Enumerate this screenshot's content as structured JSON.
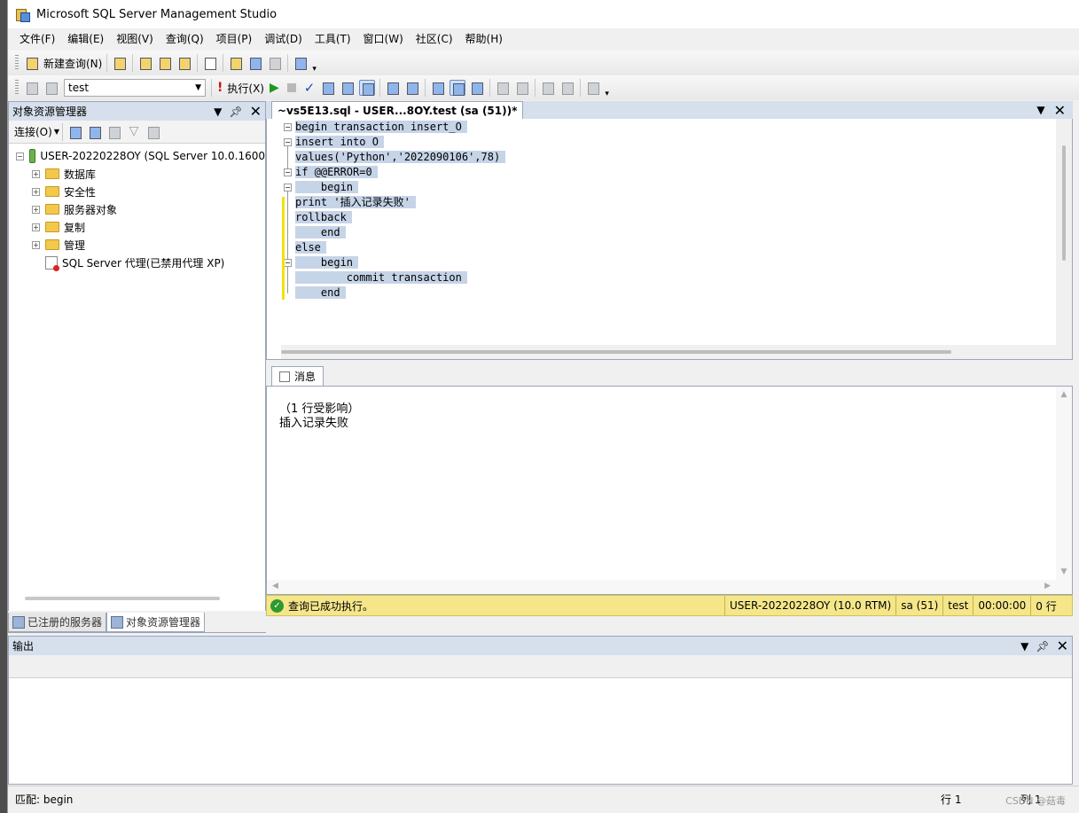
{
  "window": {
    "title": "Microsoft SQL Server Management Studio"
  },
  "menu": [
    "文件(F)",
    "编辑(E)",
    "视图(V)",
    "查询(Q)",
    "项目(P)",
    "调试(D)",
    "工具(T)",
    "窗口(W)",
    "社区(C)",
    "帮助(H)"
  ],
  "toolbar1": {
    "new_query": "新建查询(N)"
  },
  "toolbar2": {
    "database": "test",
    "execute": "执行(X)"
  },
  "object_explorer": {
    "title": "对象资源管理器",
    "connect": "连接(O)",
    "server": "USER-20220228OY (SQL Server 10.0.1600",
    "nodes": [
      "数据库",
      "安全性",
      "服务器对象",
      "复制",
      "管理"
    ],
    "agent": "SQL Server 代理(已禁用代理 XP)"
  },
  "bottom_tabs": {
    "registered": "已注册的服务器",
    "explorer": "对象资源管理器"
  },
  "editor": {
    "tab": "~vs5E13.sql - USER...8OY.test (sa (51))*",
    "lines": [
      "begin transaction insert_O",
      "insert into O",
      "values('Python','2022090106',78)",
      "if @@ERROR=0",
      "    begin",
      "print '插入记录失败'",
      "rollback",
      "    end",
      "else",
      "    begin",
      "        commit transaction",
      "    end"
    ]
  },
  "results": {
    "tab": "消息",
    "line1": "（1 行受影响）",
    "line2": "插入记录失败"
  },
  "query_status": {
    "message": "查询已成功执行。",
    "server": "USER-20220228OY (10.0 RTM)",
    "user": "sa (51)",
    "db": "test",
    "time": "00:00:00",
    "rows": "0 行"
  },
  "output": {
    "title": "输出"
  },
  "statusbar": {
    "match": "匹配: begin",
    "row": "行 1",
    "col": "列 1",
    "watermark": "CSDN @菇毒"
  }
}
